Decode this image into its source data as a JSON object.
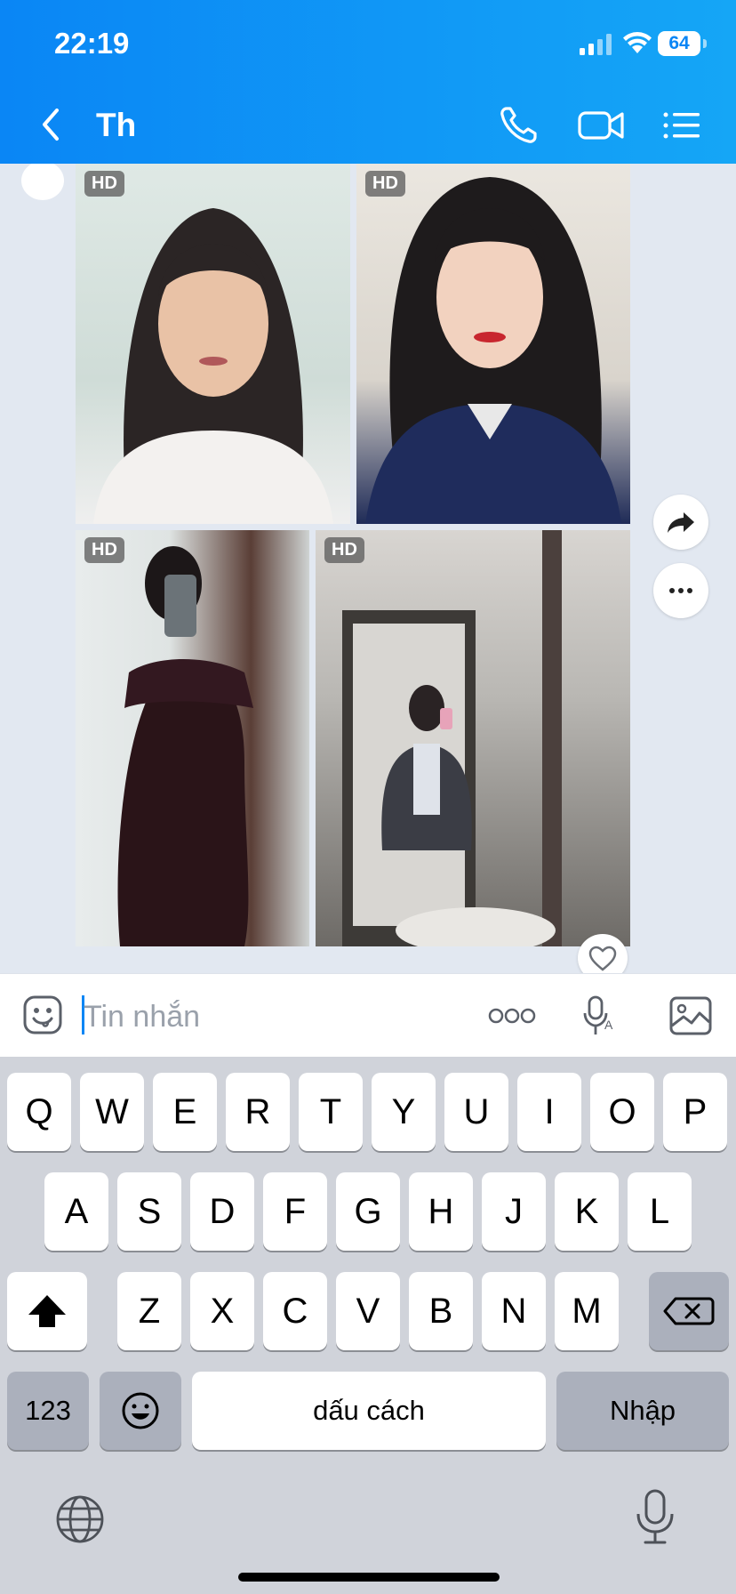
{
  "status": {
    "time": "22:19",
    "battery": "64"
  },
  "header": {
    "title": "Th",
    "icons": [
      "back-icon",
      "phone-icon",
      "video-call-icon",
      "list-menu-icon"
    ]
  },
  "chat": {
    "photos": [
      {
        "badge": "HD"
      },
      {
        "badge": "HD"
      },
      {
        "badge": "HD"
      },
      {
        "badge": "HD"
      }
    ],
    "actions": [
      "share-icon",
      "more-icon",
      "heart-icon"
    ]
  },
  "input": {
    "placeholder": "Tin nhắn",
    "icons": [
      "sticker-icon",
      "more-dots-icon",
      "voice-text-icon",
      "image-icon"
    ]
  },
  "keyboard": {
    "row1": [
      "Q",
      "W",
      "E",
      "R",
      "T",
      "Y",
      "U",
      "I",
      "O",
      "P"
    ],
    "row2": [
      "A",
      "S",
      "D",
      "F",
      "G",
      "H",
      "J",
      "K",
      "L"
    ],
    "row3": [
      "Z",
      "X",
      "C",
      "V",
      "B",
      "N",
      "M"
    ],
    "numbers_label": "123",
    "space_label": "dấu cách",
    "return_label": "Nhập"
  },
  "colors": {
    "header_start": "#0a86f5",
    "header_end": "#15a6f6",
    "chat_bg": "#e2e8f1",
    "keyboard_bg": "#d0d3da"
  }
}
